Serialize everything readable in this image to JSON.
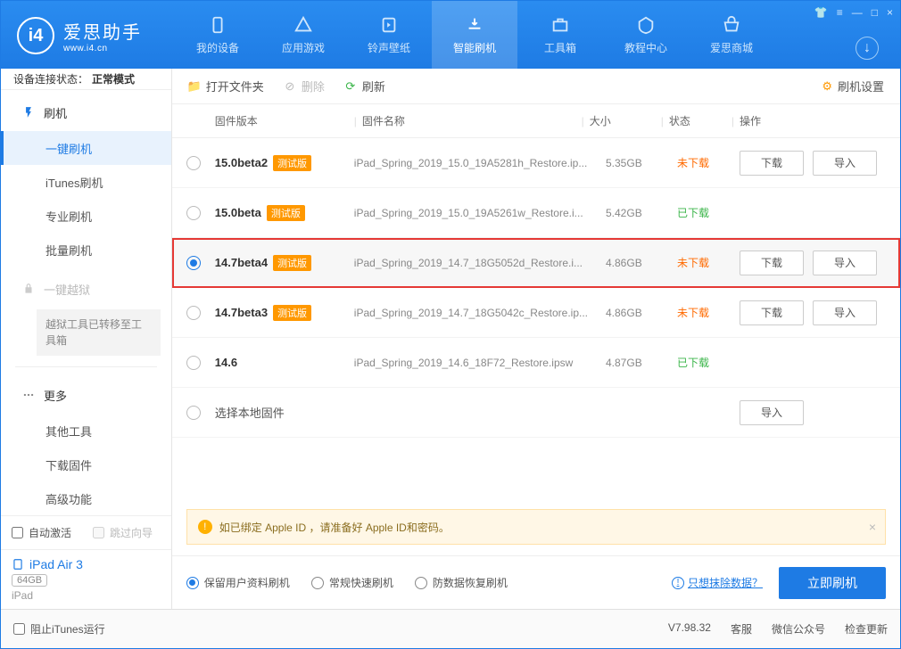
{
  "app": {
    "name": "爱思助手",
    "site": "www.i4.cn"
  },
  "nav": [
    {
      "label": "我的设备"
    },
    {
      "label": "应用游戏"
    },
    {
      "label": "铃声壁纸"
    },
    {
      "label": "智能刷机",
      "active": true
    },
    {
      "label": "工具箱"
    },
    {
      "label": "教程中心"
    },
    {
      "label": "爱思商城"
    }
  ],
  "conn": {
    "label": "设备连接状态：",
    "value": "正常模式"
  },
  "sidebar": {
    "group1_head": "刷机",
    "items1": [
      "一键刷机",
      "iTunes刷机",
      "专业刷机",
      "批量刷机"
    ],
    "group2_head": "一键越狱",
    "jailbreak_note": "越狱工具已转移至工具箱",
    "group3_head": "更多",
    "items3": [
      "其他工具",
      "下载固件",
      "高级功能"
    ],
    "auto_activate": "自动激活",
    "skip_guide": "跳过向导",
    "device_name": "iPad Air 3",
    "device_storage": "64GB",
    "device_type": "iPad"
  },
  "toolbar": {
    "open": "打开文件夹",
    "delete": "删除",
    "refresh": "刷新",
    "settings": "刷机设置"
  },
  "table": {
    "headers": {
      "version": "固件版本",
      "name": "固件名称",
      "size": "大小",
      "status": "状态",
      "ops": "操作"
    },
    "download_btn": "下载",
    "import_btn": "导入",
    "status_not": "未下载",
    "status_done": "已下载",
    "beta_badge": "测试版",
    "rows": [
      {
        "ver": "15.0beta2",
        "beta": true,
        "name": "iPad_Spring_2019_15.0_19A5281h_Restore.ip...",
        "size": "5.35GB",
        "status": "not",
        "ops": [
          "download",
          "import"
        ]
      },
      {
        "ver": "15.0beta",
        "beta": true,
        "name": "iPad_Spring_2019_15.0_19A5261w_Restore.i...",
        "size": "5.42GB",
        "status": "done",
        "ops": []
      },
      {
        "ver": "14.7beta4",
        "beta": true,
        "name": "iPad_Spring_2019_14.7_18G5052d_Restore.i...",
        "size": "4.86GB",
        "status": "not",
        "selected": true,
        "ops": [
          "download",
          "import"
        ]
      },
      {
        "ver": "14.7beta3",
        "beta": true,
        "name": "iPad_Spring_2019_14.7_18G5042c_Restore.ip...",
        "size": "4.86GB",
        "status": "not",
        "ops": [
          "download",
          "import"
        ]
      },
      {
        "ver": "14.6",
        "beta": false,
        "name": "iPad_Spring_2019_14.6_18F72_Restore.ipsw",
        "size": "4.87GB",
        "status": "done",
        "ops": []
      }
    ],
    "local_row": "选择本地固件"
  },
  "alert": "如已绑定 Apple ID ，请准备好 Apple ID和密码。",
  "flash_opts": [
    "保留用户资料刷机",
    "常规快速刷机",
    "防数据恢复刷机"
  ],
  "erase_link": "只想抹除数据？",
  "flash_btn": "立即刷机",
  "footer": {
    "block_itunes": "阻止iTunes运行",
    "version": "V7.98.32",
    "service": "客服",
    "wechat": "微信公众号",
    "update": "检查更新"
  }
}
